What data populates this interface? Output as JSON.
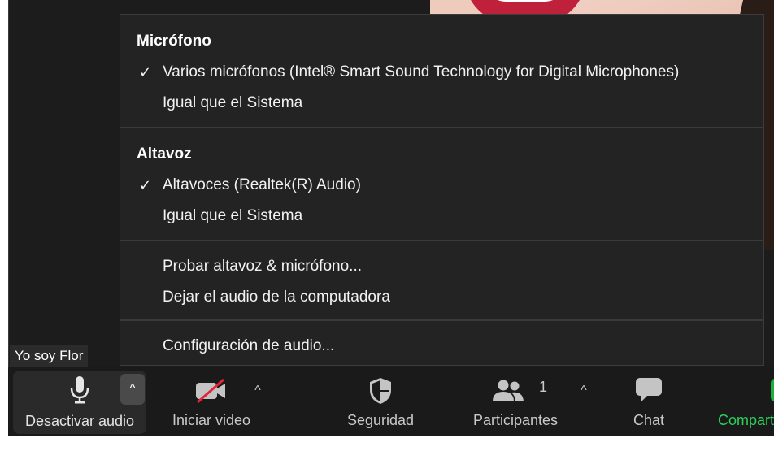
{
  "name_label": "Yo soy Flor",
  "menu": {
    "microphone": {
      "heading": "Micrófono",
      "items": [
        {
          "label": "Varios micrófonos (Intel® Smart Sound Technology for Digital Microphones)",
          "checked": true
        },
        {
          "label": "Igual que el Sistema",
          "checked": false
        }
      ]
    },
    "speaker": {
      "heading": "Altavoz",
      "items": [
        {
          "label": "Altavoces (Realtek(R) Audio)",
          "checked": true
        },
        {
          "label": "Igual que el Sistema",
          "checked": false
        }
      ]
    },
    "actions": [
      {
        "label": "Probar altavoz & micrófono..."
      },
      {
        "label": "Dejar el audio de la computadora"
      }
    ],
    "settings": {
      "label": "Configuración de audio..."
    },
    "check_glyph": "✓"
  },
  "toolbar": {
    "audio_label": "Desactivar audio",
    "video_label": "Iniciar video",
    "security_label": "Seguridad",
    "participants_label": "Participantes",
    "participants_count": "1",
    "chat_label": "Chat",
    "share_label": "Compart",
    "caret": "^"
  },
  "icons": {
    "microphone": "microphone-icon",
    "video_off": "video-off-icon",
    "shield": "shield-icon",
    "participants": "participants-icon",
    "chat": "chat-bubble-icon",
    "share": "share-screen-icon"
  },
  "colors": {
    "background": "#1c1c1c",
    "menu_bg": "#232323",
    "share_green": "#2ed05c",
    "video_off_red": "#e0263c"
  }
}
